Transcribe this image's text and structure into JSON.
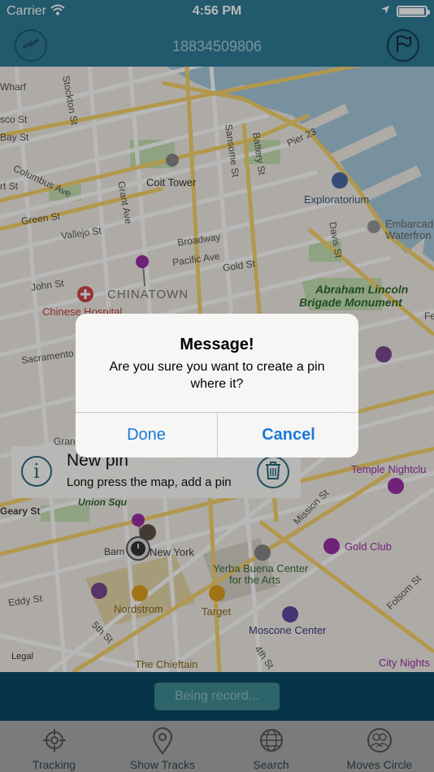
{
  "status_bar": {
    "carrier": "Carrier",
    "time": "4:56 PM"
  },
  "nav": {
    "title": "18834509806",
    "left_icon": "satellite-icon",
    "right_icon": "flag-icon"
  },
  "map": {
    "streets": [
      {
        "id": "stockton",
        "text": "Stockton St"
      },
      {
        "id": "wharf",
        "text": "Wharf"
      },
      {
        "id": "sco",
        "text": "sco St"
      },
      {
        "id": "bay",
        "text": "Bay St"
      },
      {
        "id": "columbus",
        "text": "Columbus Ave"
      },
      {
        "id": "rt",
        "text": "rt St"
      },
      {
        "id": "green",
        "text": "Green St"
      },
      {
        "id": "vallejo",
        "text": "Vallejo St"
      },
      {
        "id": "grant",
        "text": "Grant Ave"
      },
      {
        "id": "broadway",
        "text": "Broadway"
      },
      {
        "id": "pacific",
        "text": "Pacific Ave"
      },
      {
        "id": "gold",
        "text": "Gold St"
      },
      {
        "id": "john",
        "text": "John St"
      },
      {
        "id": "sacramento",
        "text": "Sacramento"
      },
      {
        "id": "sansome",
        "text": "Sansome St"
      },
      {
        "id": "battery",
        "text": "Battery St"
      },
      {
        "id": "pier",
        "text": "Pier 23"
      },
      {
        "id": "davis",
        "text": "Davis St"
      },
      {
        "id": "geary",
        "text": "Geary St"
      },
      {
        "id": "eddy",
        "text": "Eddy St"
      },
      {
        "id": "fifth",
        "text": "5th St"
      },
      {
        "id": "fourth",
        "text": "4th St"
      },
      {
        "id": "mission",
        "text": "Mission St"
      },
      {
        "id": "folsom",
        "text": "Folsom St"
      },
      {
        "id": "gran",
        "text": "Gran"
      },
      {
        "id": "barn",
        "text": "Barn"
      },
      {
        "id": "fe",
        "text": "Fe"
      },
      {
        "id": "legal",
        "text": "Legal"
      }
    ],
    "places": [
      {
        "id": "coit",
        "text": "Coit Tower"
      },
      {
        "id": "exploratorium",
        "text": "Exploratorium"
      },
      {
        "id": "embarcadero1",
        "text": "Embarcad"
      },
      {
        "id": "embarcadero2",
        "text": "Waterfron"
      },
      {
        "id": "chinatown",
        "text": "CHINATOWN"
      },
      {
        "id": "hospital",
        "text": "Chinese Hospital"
      },
      {
        "id": "lincoln1",
        "text": "Abraham Lincoln"
      },
      {
        "id": "lincoln2",
        "text": "Brigade Monument"
      },
      {
        "id": "union",
        "text": "Union Squ"
      },
      {
        "id": "newyork",
        "text": "New York"
      },
      {
        "id": "nordstrom",
        "text": "Nordstrom"
      },
      {
        "id": "target",
        "text": "Target"
      },
      {
        "id": "yerba1",
        "text": "Yerba Buena Center"
      },
      {
        "id": "yerba2",
        "text": "for the Arts"
      },
      {
        "id": "moscone",
        "text": "Moscone Center"
      },
      {
        "id": "temple",
        "text": "Temple Nightclu"
      },
      {
        "id": "goldclub",
        "text": "Gold Club"
      },
      {
        "id": "chieftain",
        "text": "The Chieftain"
      },
      {
        "id": "citynights",
        "text": "City Nights"
      }
    ],
    "colors": {
      "land": "#f1eee6",
      "water": "#a7c9dd",
      "park": "#c7e2b4",
      "road_major": "#f6d36b",
      "road_minor": "#ffffff",
      "pin": "#9b2fa8"
    }
  },
  "tip": {
    "title": "New pin",
    "subtitle": "Long press the map, add a pin",
    "info_glyph": "i"
  },
  "alert": {
    "title": "Message!",
    "message": "Are you sure you want to create a pin where it?",
    "done_label": "Done",
    "cancel_label": "Cancel"
  },
  "record": {
    "label": "Being record..."
  },
  "tabs": [
    {
      "label": "Tracking",
      "icon": "crosshair-icon"
    },
    {
      "label": "Show Tracks",
      "icon": "location-pin-icon"
    },
    {
      "label": "Search",
      "icon": "globe-icon"
    },
    {
      "label": "Moves Circle",
      "icon": "people-icon"
    }
  ]
}
